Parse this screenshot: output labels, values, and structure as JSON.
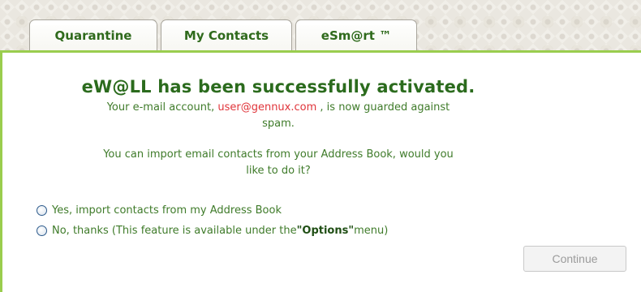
{
  "tabs": [
    {
      "label": "Quarantine"
    },
    {
      "label": "My Contacts"
    },
    {
      "label": "eSm@rt ™"
    }
  ],
  "message": {
    "title": "eW@LL has been successfully activated.",
    "account_prefix": "Your e-mail account, ",
    "account_email": "user@gennux.com",
    "account_suffix": ", is now guarded against",
    "account_suffix_2": "spam.",
    "question_line1": "You can import email contacts from your Address Book, would you",
    "question_line2": "like to do it?"
  },
  "options": {
    "yes_label": "Yes, import contacts from my Address Book",
    "no_prefix": "No, thanks (This feature is available under the ",
    "no_options_word": "\"Options\"",
    "no_suffix": " menu)"
  },
  "buttons": {
    "continue_label": "Continue"
  },
  "colors": {
    "accent_green": "#9acd4e",
    "text_green": "#3f7b2a",
    "title_green": "#2b6b1d",
    "email_red": "#e0343a"
  }
}
